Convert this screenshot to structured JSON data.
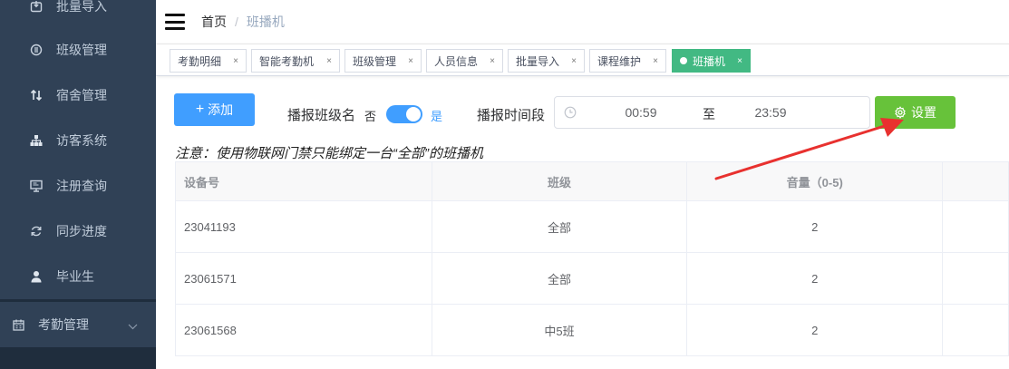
{
  "sidebar": {
    "items": [
      {
        "label": "批量导入",
        "icon": "import-icon"
      },
      {
        "label": "班级管理",
        "icon": "class-icon"
      },
      {
        "label": "宿舍管理",
        "icon": "sort-arrows-icon"
      },
      {
        "label": "访客系统",
        "icon": "org-chart-icon"
      },
      {
        "label": "注册查询",
        "icon": "monitor-icon"
      },
      {
        "label": "同步进度",
        "icon": "sync-icon"
      },
      {
        "label": "毕业生",
        "icon": "user-icon"
      }
    ],
    "group": {
      "label": "考勤管理",
      "icon": "calendar-icon"
    }
  },
  "breadcrumb": {
    "home": "首页",
    "separator": "/",
    "current": "班播机"
  },
  "tags": [
    {
      "label": "考勤明细",
      "close": "×"
    },
    {
      "label": "智能考勤机",
      "close": "×"
    },
    {
      "label": "班级管理",
      "close": "×"
    },
    {
      "label": "人员信息",
      "close": "×"
    },
    {
      "label": "批量导入",
      "close": "×"
    },
    {
      "label": "课程维护",
      "close": "×"
    },
    {
      "label": "班播机",
      "close": "×",
      "active": true
    }
  ],
  "toolbar": {
    "add_label": "添加",
    "add_icon": "+",
    "announce_label": "播报班级名",
    "switch_off": "否",
    "switch_on": "是",
    "switch_checked": true,
    "period_label": "播报时间段",
    "start_time": "00:59",
    "range_separator": "至",
    "end_time": "23:59",
    "settings_label": "设置"
  },
  "notice": "注意：使用物联网门禁只能绑定一台“全部”的班播机",
  "table": {
    "columns": [
      "设备号",
      "班级",
      "音量（0-5)"
    ],
    "rows": [
      {
        "device": "23041193",
        "class": "全部",
        "volume": "2"
      },
      {
        "device": "23061571",
        "class": "全部",
        "volume": "2"
      },
      {
        "device": "23061568",
        "class": "中5班",
        "volume": "2"
      }
    ]
  },
  "colors": {
    "sidebar": "#304156",
    "primary": "#409eff",
    "success": "#67c23a",
    "active_tag": "#42b983",
    "annotation_arrow": "#e8312f"
  }
}
